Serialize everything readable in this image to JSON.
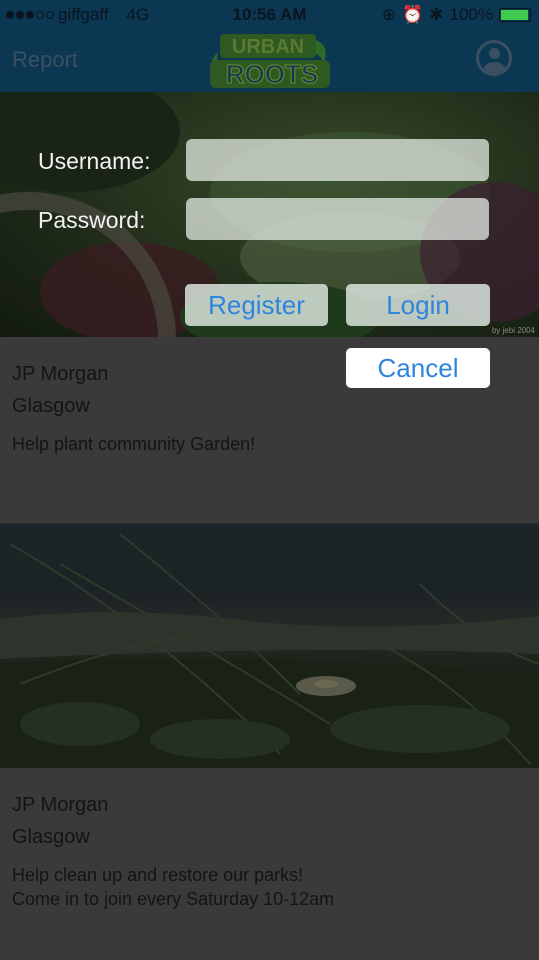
{
  "status_bar": {
    "carrier": "giffgaff",
    "network": "4G",
    "time": "10:56 AM",
    "battery": "100%",
    "signal_bars_filled": 3,
    "signal_bars_total": 5,
    "battery_level": 1.0
  },
  "nav": {
    "report_label": "Report",
    "logo_text_top": "URBAN",
    "logo_text_bottom": "ROOTS"
  },
  "login": {
    "username_label": "Username:",
    "password_label": "Password:",
    "username_value": "",
    "password_value": "",
    "register_label": "Register",
    "login_label": "Login",
    "cancel_label": "Cancel"
  },
  "banner": {
    "credit": "by jebi 2004"
  },
  "posts": [
    {
      "organization": "JP Morgan",
      "location": "Glasgow",
      "description": "Help plant community Garden!"
    },
    {
      "organization": "JP Morgan",
      "location": "Glasgow",
      "description_line1": "Help clean up and restore our parks!",
      "description_line2": "Come in to join every Saturday 10-12am"
    }
  ],
  "colors": {
    "nav_bg": "#0c3753",
    "button_text": "#2f84de",
    "battery_fill": "#3fc94d",
    "overlay_dim": "#3a3a3a"
  }
}
